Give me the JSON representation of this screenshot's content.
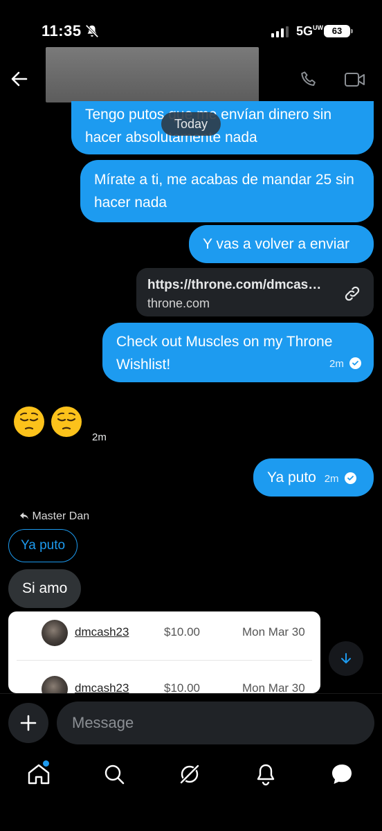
{
  "status_bar": {
    "time": "11:35",
    "network": "5G",
    "network_sub": "UW",
    "battery": "63"
  },
  "header": {
    "contact_name": ""
  },
  "date_divider": "Today",
  "messages_out": {
    "m1": "Tengo putos que me envían dinero sin hacer absolutamente nada",
    "m2": "Mírate a ti, me acabas de mandar 25 sin hacer nada",
    "m3": "Y vas a volver a enviar",
    "link": {
      "url": "https://throne.com/dmcas…",
      "domain": "throne.com"
    },
    "m4": "Check out Muscles on my Throne Wishlist!",
    "m4_time": "2m",
    "m5": "Ya puto",
    "m5_time": "2m"
  },
  "incoming": {
    "emoji_time": "2m",
    "reply_to": "Master Dan",
    "quoted_text": "Ya puto",
    "reply_text": "Si amo"
  },
  "payments": [
    {
      "user": "dmcash23",
      "amount": "$10.00",
      "date": "Mon Mar 30"
    },
    {
      "user": "dmcash23",
      "amount": "$10.00",
      "date": "Mon Mar 30"
    }
  ],
  "composer": {
    "placeholder": "Message"
  },
  "colors": {
    "accent": "#1d9bf0",
    "background": "#000000",
    "incoming_bubble": "#2f3336"
  },
  "icons": [
    "back-arrow-icon",
    "phone-icon",
    "video-icon",
    "link-icon",
    "plus-icon",
    "home-icon",
    "search-icon",
    "grok-icon",
    "bell-icon",
    "messages-icon"
  ]
}
